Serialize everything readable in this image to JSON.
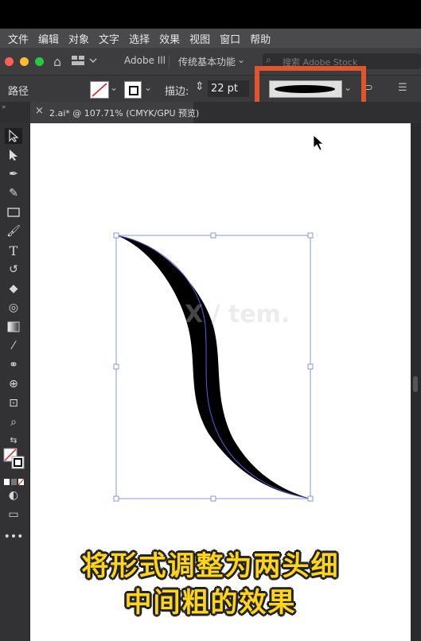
{
  "menu": [
    "文件",
    "编辑",
    "对象",
    "文字",
    "选择",
    "效果",
    "视图",
    "窗口",
    "帮助"
  ],
  "controlbar": {
    "app_label": "Adobe Ill",
    "workspace_label": "传统基本功能",
    "search_placeholder": "搜索 Adobe Stock"
  },
  "propbar": {
    "object_type": "路径",
    "stroke_label": "描边:",
    "stroke_value": "22 pt"
  },
  "document_tab": {
    "close": "×",
    "title": "2.ai* @ 107.71% (CMYK/GPU 预览)"
  },
  "caption": {
    "line1": "将形式调整为两头细",
    "line2": "中间粗的效果"
  },
  "watermark": "X / tem.",
  "colors": {
    "highlight_box": "#e0542e",
    "caption_yellow": "#ffd51a",
    "path_blue": "#5a5ee0",
    "stroke_fill": "#000000"
  }
}
